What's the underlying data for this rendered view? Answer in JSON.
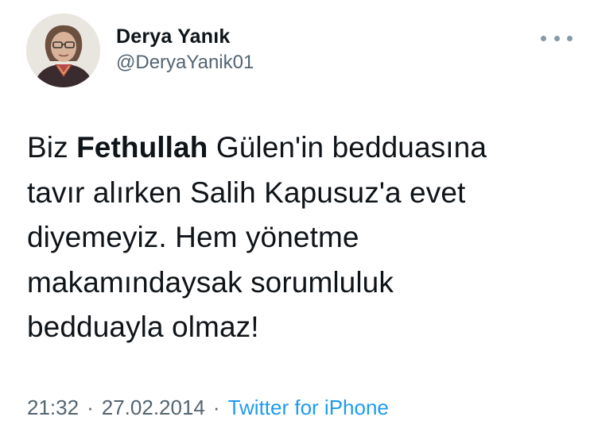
{
  "author": {
    "display_name": "Derya Yanık",
    "handle": "@DeryaYanik01"
  },
  "tweet": {
    "text_part1": "Biz ",
    "text_bold": "Fethullah",
    "text_part2": " Gülen'in bedduasına tavır alırken Salih Kapusuz'a evet diyemeyiz. Hem yönetme makamındaysak sorumluluk bedduayla olmaz!",
    "time": "21:32",
    "separator": "·",
    "date": "27.02.2014",
    "source": "Twitter for iPhone"
  },
  "icons": {
    "more": "more-options-icon",
    "avatar": "profile-photo"
  },
  "colors": {
    "text": "#0f1419",
    "secondary": "#536471",
    "link": "#1d9bf0"
  }
}
